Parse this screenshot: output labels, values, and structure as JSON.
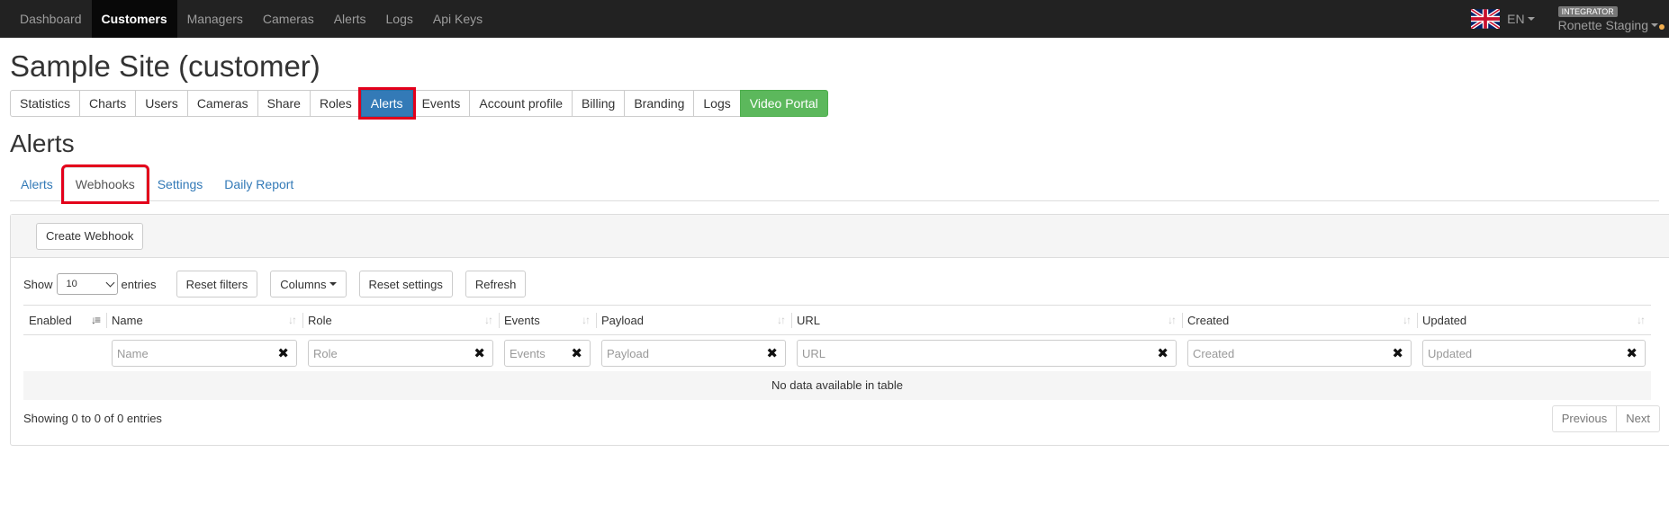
{
  "navbar": {
    "items": [
      {
        "label": "Dashboard",
        "active": false
      },
      {
        "label": "Customers",
        "active": true
      },
      {
        "label": "Managers",
        "active": false
      },
      {
        "label": "Cameras",
        "active": false
      },
      {
        "label": "Alerts",
        "active": false
      },
      {
        "label": "Logs",
        "active": false
      },
      {
        "label": "Api Keys",
        "active": false
      }
    ],
    "flag_icon": "uk-flag-icon",
    "language": "EN",
    "role_badge": "INTEGRATOR",
    "user_name": "Ronette Staging",
    "notification_dot_color": "#f0ad4e"
  },
  "page": {
    "title": "Sample Site (customer)",
    "section_title": "Alerts"
  },
  "customer_tabs": [
    {
      "label": "Statistics",
      "style": "default"
    },
    {
      "label": "Charts",
      "style": "default"
    },
    {
      "label": "Users",
      "style": "default"
    },
    {
      "label": "Cameras",
      "style": "default"
    },
    {
      "label": "Share",
      "style": "default"
    },
    {
      "label": "Roles",
      "style": "default"
    },
    {
      "label": "Alerts",
      "style": "primary"
    },
    {
      "label": "Events",
      "style": "default"
    },
    {
      "label": "Account profile",
      "style": "default"
    },
    {
      "label": "Billing",
      "style": "default"
    },
    {
      "label": "Branding",
      "style": "default"
    },
    {
      "label": "Logs",
      "style": "default"
    },
    {
      "label": "Video Portal",
      "style": "success"
    }
  ],
  "alert_tabs": [
    {
      "label": "Alerts",
      "active": false
    },
    {
      "label": "Webhooks",
      "active": true
    },
    {
      "label": "Settings",
      "active": false
    },
    {
      "label": "Daily Report",
      "active": false
    }
  ],
  "panel": {
    "create_button": "Create Webhook",
    "show_label": "Show",
    "page_length": "10",
    "entries_label": "entries",
    "reset_filters": "Reset filters",
    "columns": "Columns",
    "reset_settings": "Reset settings",
    "refresh": "Refresh"
  },
  "table": {
    "columns": [
      {
        "label": "Enabled",
        "filter_placeholder": ""
      },
      {
        "label": "Name",
        "filter_placeholder": "Name"
      },
      {
        "label": "Role",
        "filter_placeholder": "Role"
      },
      {
        "label": "Events",
        "filter_placeholder": "Events"
      },
      {
        "label": "Payload",
        "filter_placeholder": "Payload"
      },
      {
        "label": "URL",
        "filter_placeholder": "URL"
      },
      {
        "label": "Created",
        "filter_placeholder": "Created"
      },
      {
        "label": "Updated",
        "filter_placeholder": "Updated"
      }
    ],
    "empty_message": "No data available in table",
    "info": "Showing 0 to 0 of 0 entries",
    "previous": "Previous",
    "next": "Next"
  },
  "colors": {
    "primary": "#337ab7",
    "success": "#5cb85c",
    "highlight": "#e3001b",
    "navbar_bg": "#222222"
  }
}
